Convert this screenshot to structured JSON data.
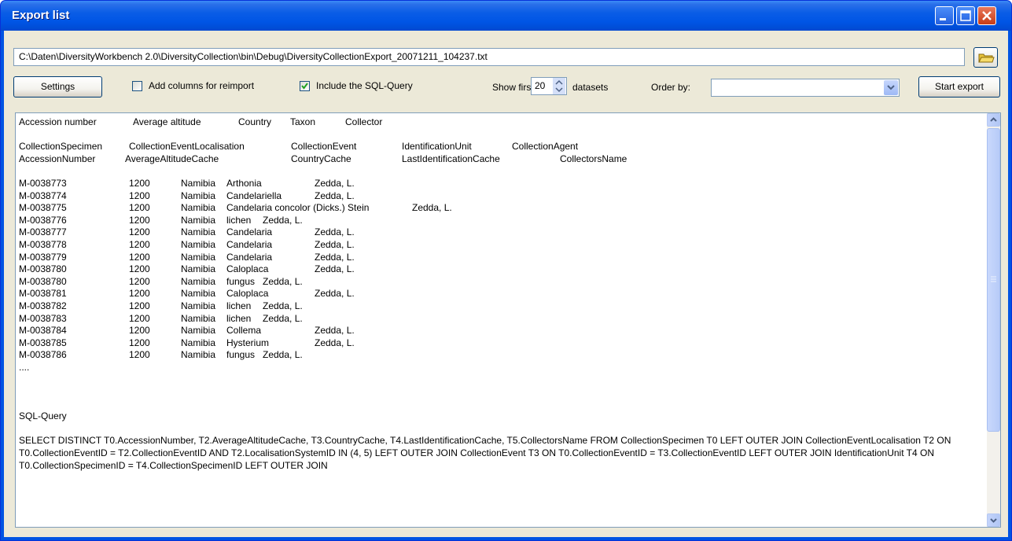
{
  "window": {
    "title": "Export list"
  },
  "path_field": {
    "value": "C:\\Daten\\DiversityWorkbench 2.0\\DiversityCollection\\bin\\Debug\\DiversityCollectionExport_20071211_104237.txt"
  },
  "toolbar": {
    "settings_label": "Settings",
    "reimport_label": "Add columns for reimport",
    "reimport_checked": false,
    "sql_label": "Include the SQL-Query",
    "sql_checked": true,
    "show_first_label": "Show first",
    "show_first_value": "20",
    "datasets_label": "datasets",
    "order_by_label": "Order by:",
    "order_by_value": "",
    "start_label": "Start export"
  },
  "output": {
    "header_captions": [
      "Accession number",
      "Average altitude",
      "Country",
      "Taxon",
      "Collector"
    ],
    "tables": [
      "CollectionSpecimen",
      "CollectionEventLocalisation",
      "CollectionEvent",
      "IdentificationUnit",
      "CollectionAgent"
    ],
    "columns": [
      "AccessionNumber",
      "AverageAltitudeCache",
      "CountryCache",
      "LastIdentificationCache",
      "CollectorsName"
    ],
    "rows": [
      [
        "M-0038773",
        "1200",
        "Namibia",
        "Arthonia",
        "Zedda, L."
      ],
      [
        "M-0038774",
        "1200",
        "Namibia",
        "Candelariella",
        "Zedda, L."
      ],
      [
        "M-0038775",
        "1200",
        "Namibia",
        "Candelaria concolor (Dicks.) Stein",
        "Zedda, L."
      ],
      [
        "M-0038776",
        "1200",
        "Namibia",
        "lichen",
        "Zedda, L."
      ],
      [
        "M-0038777",
        "1200",
        "Namibia",
        "Candelaria",
        "Zedda, L."
      ],
      [
        "M-0038778",
        "1200",
        "Namibia",
        "Candelaria",
        "Zedda, L."
      ],
      [
        "M-0038779",
        "1200",
        "Namibia",
        "Candelaria",
        "Zedda, L."
      ],
      [
        "M-0038780",
        "1200",
        "Namibia",
        "Caloplaca",
        "Zedda, L."
      ],
      [
        "M-0038780",
        "1200",
        "Namibia",
        "fungus",
        "Zedda, L."
      ],
      [
        "M-0038781",
        "1200",
        "Namibia",
        "Caloplaca",
        "Zedda, L."
      ],
      [
        "M-0038782",
        "1200",
        "Namibia",
        "lichen",
        "Zedda, L."
      ],
      [
        "M-0038783",
        "1200",
        "Namibia",
        "lichen",
        "Zedda, L."
      ],
      [
        "M-0038784",
        "1200",
        "Namibia",
        "Collema",
        "Zedda, L."
      ],
      [
        "M-0038785",
        "1200",
        "Namibia",
        "Hysterium",
        "Zedda, L."
      ],
      [
        "M-0038786",
        "1200",
        "Namibia",
        "fungus",
        "Zedda, L."
      ]
    ],
    "ellipsis": "....",
    "sql_heading": "SQL-Query",
    "sql_text": "SELECT DISTINCT T0.AccessionNumber, T2.AverageAltitudeCache, T3.CountryCache, T4.LastIdentificationCache, T5.CollectorsName FROM CollectionSpecimen T0  LEFT OUTER JOIN CollectionEventLocalisation T2 ON T0.CollectionEventID = T2.CollectionEventID AND T2.LocalisationSystemID IN (4, 5) LEFT OUTER JOIN CollectionEvent T3 ON T0.CollectionEventID = T3.CollectionEventID LEFT OUTER JOIN IdentificationUnit T4 ON T0.CollectionSpecimenID = T4.CollectionSpecimenID LEFT OUTER JOIN"
  },
  "icons": {
    "folder": "folder-icon",
    "minimize": "minimize-icon",
    "maximize": "maximize-icon",
    "close": "close-icon"
  },
  "colors": {
    "titlebar": "#0055e5",
    "client": "#ece9d8",
    "check": "#21a121"
  }
}
